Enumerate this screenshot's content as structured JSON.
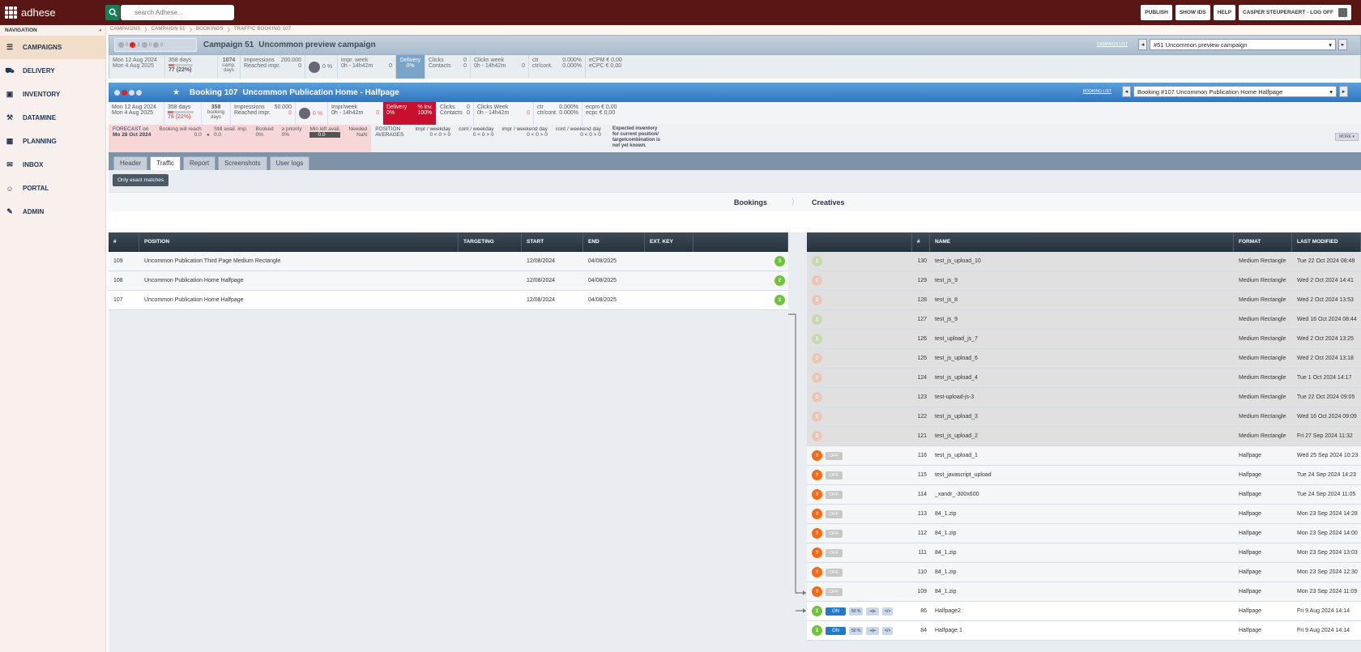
{
  "app": {
    "logo": "adhese",
    "search_placeholder": "search Adhese...",
    "buttons": [
      "PUBLISH",
      "SHOW IDS",
      "HELP"
    ],
    "user": "CASPER STEUPERAERT - LOG OFF"
  },
  "nav": {
    "header": "NAVIGATION",
    "items": [
      {
        "label": "CAMPAIGNS",
        "icon": "campaigns-icon",
        "glyph": "☰"
      },
      {
        "label": "DELIVERY",
        "icon": "truck-icon",
        "glyph": "⛟"
      },
      {
        "label": "INVENTORY",
        "icon": "briefcase-icon",
        "glyph": "▣"
      },
      {
        "label": "DATAMINE",
        "icon": "pickaxe-icon",
        "glyph": "⚒"
      },
      {
        "label": "PLANNING",
        "icon": "calendar-icon",
        "glyph": "▦"
      },
      {
        "label": "INBOX",
        "icon": "mail-icon",
        "glyph": "✉"
      },
      {
        "label": "PORTAL",
        "icon": "person-icon",
        "glyph": "☺"
      },
      {
        "label": "ADMIN",
        "icon": "wrench-icon",
        "glyph": "✎"
      }
    ]
  },
  "breadcrumb": [
    "CAMPAIGNS",
    "CAMPAIGN 51",
    "BOOKINGS",
    "TRAFFIC BOOKING 107"
  ],
  "campaign": {
    "title": "Campaign 51",
    "name": "Uncommon preview campaign",
    "counts": [
      "0",
      "3",
      "0",
      "0"
    ],
    "link": "CAMPAIGN LIST",
    "select": "#51 Uncommon preview campaign",
    "start": "Mon 12 Aug 2024",
    "end": "Mon 4 Aug 2025",
    "days": "358 days",
    "done": "77 (22%)",
    "camp_days": "1074",
    "camp_days_label": "camp. days",
    "impressions_label": "Impressions",
    "impressions": "200.000",
    "reached_label": "Reached impr.",
    "reached": "0",
    "pct": "0 %",
    "impr_week_label": "impr. week",
    "impr_week_sub": "0h - 14h42m",
    "impr_week": "0",
    "delivery_label": "Delivery",
    "delivery_pct": "0%",
    "clicks_label": "Clicks",
    "clicks": "0",
    "contacts_label": "Contacts",
    "contacts": "0",
    "clicks_week_label": "Clicks week",
    "clicks_week_sub": "0h - 14h42m",
    "clicks_week": "0",
    "ctr_label": "ctr",
    "ctr": "0.000%",
    "ctrcont_label": "ctr/cont.",
    "ctrcont": "0.000%",
    "ecpm_label": "eCPM",
    "ecpm": "€ 0,00",
    "ecpc_label": "eCPC",
    "ecpc": "€ 0,00"
  },
  "booking": {
    "title": "Booking 107",
    "name": "Uncommon Publication Home - Halfpage",
    "link": "BOOKING LIST",
    "select": "Booking #107 Uncommon Publication Home Halfpage",
    "start": "Mon 12 Aug 2024",
    "end": "Mon 4 Aug 2025",
    "days": "358 days",
    "done": "78 (22%)",
    "bdays": "358",
    "bdays_label": "booking days",
    "impressions_label": "Impressions",
    "impressions": "50.000",
    "reached_label": "Reached impr.",
    "reached": "0",
    "pct": "0 %",
    "iw_label": "Impr/week",
    "iw_sub": "0h - 14h42m",
    "iw": "0",
    "delivery_label": "Delivery",
    "delivery_pct": "0%",
    "inv_label": "% inv.",
    "inv_pct": "100%",
    "clicks_label": "Clicks",
    "clicks": "0",
    "contacts_label": "Contacts",
    "contacts": "0",
    "cw_label": "Clicks Week",
    "cw_sub": "0h - 14h42m",
    "cw": "0",
    "ctr_label": "ctr",
    "ctr": "0.000%",
    "ctrcont_label": "ctr/cont.",
    "ctrcont": "0.000%",
    "ecpm_label": "ecpm",
    "ecpm": "€ 0,00",
    "ecpc_label": "ecpc",
    "ecpc": "€ 0,00"
  },
  "forecast": {
    "label": "FORECAST on",
    "date": "Mo 28 Oct 2024",
    "reach_label": "Booking will reach",
    "reach": "0.0",
    "still_label": "Still avail. imp.",
    "still": "0.0",
    "booked_label": "Booked",
    "booked": "0%",
    "prio_label": "≥ priority",
    "prio": "0%",
    "min_label": "Min left avail.",
    "min": "0.0",
    "needed_label": "Needed",
    "needed": "NaN",
    "pos_label": "POSITION",
    "avg_label": "AVERAGES",
    "cols": [
      [
        "impr / weekday",
        "0 < 0 > 0"
      ],
      [
        "cont / weekday",
        "0 < 0 > 0"
      ],
      [
        "impr / weekend day",
        "0 < 0 > 0"
      ],
      [
        "cont / weekend day",
        "0 < 0 > 0"
      ]
    ],
    "note": "Expected inventory for current position/ targetcombination is not yet known.",
    "more": "MORE ▾"
  },
  "tabs": [
    "Header",
    "Traffic",
    "Report",
    "Screenshots",
    "User logs"
  ],
  "filter": "Only exact matches",
  "sections": {
    "left": "Bookings",
    "right": "Creatives"
  },
  "bookings": {
    "headers": [
      "#",
      "POSITION",
      "TARGETING",
      "START",
      "END",
      "EXT. KEY"
    ],
    "rows": [
      {
        "id": "109",
        "pos": "Uncommon Publication Third Page Medium Rectangle",
        "start": "12/08/2024",
        "end": "04/08/2025",
        "count": "3"
      },
      {
        "id": "108",
        "pos": "Uncommon Publication Home Halfpage",
        "start": "12/08/2024",
        "end": "04/08/2025",
        "count": "2"
      },
      {
        "id": "107",
        "pos": "Uncommon Publication Home Halfpage",
        "start": "12/08/2024",
        "end": "04/08/2025",
        "count": "2"
      }
    ]
  },
  "creatives": {
    "headers": [
      "#",
      "NAME",
      "FORMAT",
      "LAST MODIFIED"
    ],
    "rows": [
      {
        "b": "1",
        "st": "",
        "id": "130",
        "name": "test_js_upload_10",
        "format": "Medium Rectangle",
        "mod": "Tue 22 Oct 2024 08:48",
        "t": "lg"
      },
      {
        "b": "0",
        "st": "",
        "id": "129",
        "name": "test_js_9",
        "format": "Medium Rectangle",
        "mod": "Wed 2 Oct 2024 14:41",
        "t": "lo"
      },
      {
        "b": "0",
        "st": "",
        "id": "128",
        "name": "test_js_8",
        "format": "Medium Rectangle",
        "mod": "Wed 2 Oct 2024 13:53",
        "t": "lo"
      },
      {
        "b": "1",
        "st": "",
        "id": "127",
        "name": "test_js_9",
        "format": "Medium Rectangle",
        "mod": "Wed 16 Oct 2024 08:44",
        "t": "lg"
      },
      {
        "b": "1",
        "st": "",
        "id": "126",
        "name": "test_upload_js_7",
        "format": "Medium Rectangle",
        "mod": "Wed 2 Oct 2024 13:25",
        "t": "lg"
      },
      {
        "b": "0",
        "st": "",
        "id": "125",
        "name": "test_js_upload_6",
        "format": "Medium Rectangle",
        "mod": "Wed 2 Oct 2024 13:18",
        "t": "lo"
      },
      {
        "b": "0",
        "st": "",
        "id": "124",
        "name": "test_js_upload_4",
        "format": "Medium Rectangle",
        "mod": "Tue 1 Oct 2024 14:17",
        "t": "lo"
      },
      {
        "b": "0",
        "st": "",
        "id": "123",
        "name": "test-upload-js-3",
        "format": "Medium Rectangle",
        "mod": "Tue 22 Oct 2024 09:05",
        "t": "lo"
      },
      {
        "b": "0",
        "st": "",
        "id": "122",
        "name": "test_js_upload_3",
        "format": "Medium Rectangle",
        "mod": "Wed 16 Oct 2024 09:09",
        "t": "lo"
      },
      {
        "b": "0",
        "st": "",
        "id": "121",
        "name": "test_js_upload_2",
        "format": "Medium Rectangle",
        "mod": "Fri 27 Sep 2024 11:32",
        "t": "lo"
      },
      {
        "b": "0",
        "st": "OFF",
        "id": "116",
        "name": "test_js_upload_1",
        "format": "Halfpage",
        "mod": "Wed 25 Sep 2024 10:23",
        "t": "o"
      },
      {
        "b": "0",
        "st": "OFF",
        "id": "115",
        "name": "test_javascript_upload",
        "format": "Halfpage",
        "mod": "Tue 24 Sep 2024 14:23",
        "t": "o"
      },
      {
        "b": "0",
        "st": "OFF",
        "id": "114",
        "name": "_xandr_-300x600",
        "format": "Halfpage",
        "mod": "Tue 24 Sep 2024 11:05",
        "t": "o"
      },
      {
        "b": "0",
        "st": "OFF",
        "id": "113",
        "name": "84_1.zip",
        "format": "Halfpage",
        "mod": "Mon 23 Sep 2024 14:28",
        "t": "o"
      },
      {
        "b": "0",
        "st": "OFF",
        "id": "112",
        "name": "84_1.zip",
        "format": "Halfpage",
        "mod": "Mon 23 Sep 2024 14:00",
        "t": "o"
      },
      {
        "b": "0",
        "st": "OFF",
        "id": "111",
        "name": "84_1.zip",
        "format": "Halfpage",
        "mod": "Mon 23 Sep 2024 13:03",
        "t": "o"
      },
      {
        "b": "0",
        "st": "OFF",
        "id": "110",
        "name": "84_1.zip",
        "format": "Halfpage",
        "mod": "Mon 23 Sep 2024 12:30",
        "t": "o"
      },
      {
        "b": "0",
        "st": "OFF",
        "id": "109",
        "name": "84_1.zip",
        "format": "Halfpage",
        "mod": "Mon 23 Sep 2024 11:09",
        "t": "o"
      },
      {
        "b": "2",
        "st": "ON",
        "id": "86",
        "name": "Halfpage2",
        "format": "Halfpage",
        "mod": "Fri 9 Aug 2024 14:14",
        "t": "g"
      },
      {
        "b": "2",
        "st": "ON",
        "id": "84",
        "name": "Halfpage 1",
        "format": "Halfpage",
        "mod": "Fri 9 Aug 2024 14:14",
        "t": "g"
      }
    ],
    "weight": "50 %",
    "tools": [
      "⇥|⇤",
      "</>"
    ]
  }
}
